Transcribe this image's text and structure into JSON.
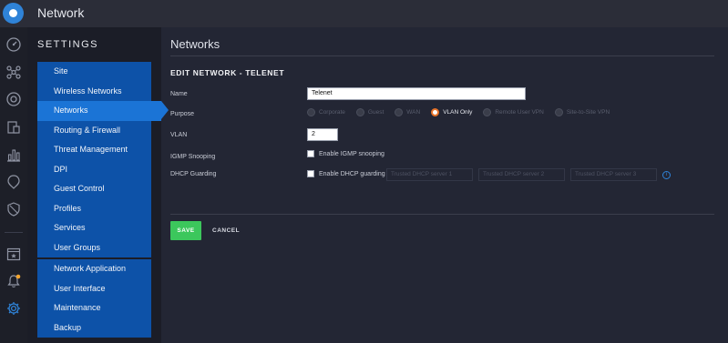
{
  "app": {
    "title": "Network"
  },
  "settings": {
    "title": "SETTINGS",
    "menu_group1": [
      {
        "label": "Site"
      },
      {
        "label": "Wireless Networks"
      },
      {
        "label": "Networks"
      },
      {
        "label": "Routing & Firewall"
      },
      {
        "label": "Threat Management"
      },
      {
        "label": "DPI"
      },
      {
        "label": "Guest Control"
      },
      {
        "label": "Profiles"
      },
      {
        "label": "Services"
      },
      {
        "label": "User Groups"
      }
    ],
    "menu_group2": [
      {
        "label": "Network Application"
      },
      {
        "label": "User Interface"
      },
      {
        "label": "Maintenance"
      },
      {
        "label": "Backup"
      }
    ],
    "active_item": "Networks"
  },
  "page": {
    "title": "Networks",
    "section_title": "EDIT NETWORK - TELENET"
  },
  "form": {
    "name_label": "Name",
    "name_value": "Telenet",
    "purpose_label": "Purpose",
    "purpose_options": [
      "Corporate",
      "Guest",
      "WAN",
      "VLAN Only",
      "Remote User VPN",
      "Site-to-Site VPN"
    ],
    "purpose_selected": "VLAN Only",
    "vlan_label": "VLAN",
    "vlan_value": "2",
    "igmp_label": "IGMP Snooping",
    "igmp_checkbox": "Enable IGMP snooping",
    "dhcp_label": "DHCP Guarding",
    "dhcp_checkbox": "Enable DHCP guarding",
    "dhcp_placeholders": [
      "Trusted DHCP server 1",
      "Trusted DHCP server 2",
      "Trusted DHCP server 3"
    ]
  },
  "actions": {
    "save": "SAVE",
    "cancel": "CANCEL"
  },
  "colors": {
    "accent": "#2f83d8",
    "menu": "#0d52a8",
    "menu_active": "#1b74d6",
    "save": "#3cc75c",
    "radio_selected": "#e8742a"
  },
  "rail_icons": [
    "dashboard-icon",
    "topology-icon",
    "devices-icon",
    "clients-icon",
    "statistics-icon",
    "insights-icon",
    "shield-icon",
    "events-icon",
    "alerts-icon",
    "settings-gear-icon"
  ]
}
